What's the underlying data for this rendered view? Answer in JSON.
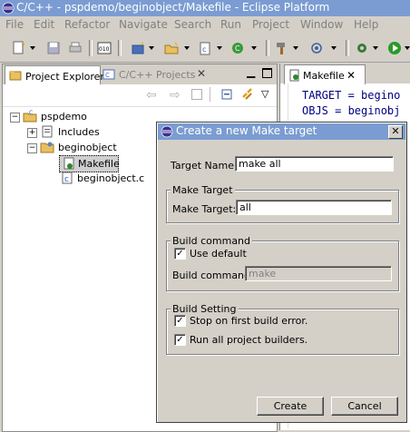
{
  "window": {
    "title": "C/C++ - pspdemo/beginobject/Makefile - Eclipse Platform"
  },
  "menu": [
    "File",
    "Edit",
    "Refactor",
    "Navigate",
    "Search",
    "Run",
    "Project",
    "Window",
    "Help"
  ],
  "left_view": {
    "tabs": [
      {
        "label": "Project Explorer"
      },
      {
        "label": "C/C++ Projects"
      }
    ],
    "tree": [
      {
        "label": "pspdemo",
        "expander": "−"
      },
      {
        "label": "Includes",
        "expander": "+"
      },
      {
        "label": "beginobject",
        "expander": "−"
      },
      {
        "label": "Makefile"
      },
      {
        "label": "beginobject.c"
      }
    ]
  },
  "editor": {
    "tab_label": "Makefile",
    "lines": [
      "TARGET = begino",
      "OBJS = beginobj"
    ]
  },
  "dialog": {
    "title": "Create a new Make target",
    "close_glyph": "✕",
    "target_name_label": "Target Name:",
    "target_name_value": "make all",
    "make_target_group": "Make Target",
    "make_target_label": "Make Target:",
    "make_target_value": "all",
    "build_command_group": "Build command",
    "use_default_label": "Use default",
    "use_default_checked": true,
    "build_command_label": "Build command:",
    "build_command_value": "make",
    "build_setting_group": "Build Setting",
    "stop_on_error_label": "Stop on first build error.",
    "stop_on_error_checked": true,
    "run_all_builders_label": "Run all project builders.",
    "run_all_builders_checked": true,
    "create_label": "Create",
    "cancel_label": "Cancel",
    "check_glyph": "✓"
  },
  "colors": {
    "title_bar": "#7b9cd2",
    "chrome": "#d4d0c8",
    "code_text": "#000080"
  }
}
